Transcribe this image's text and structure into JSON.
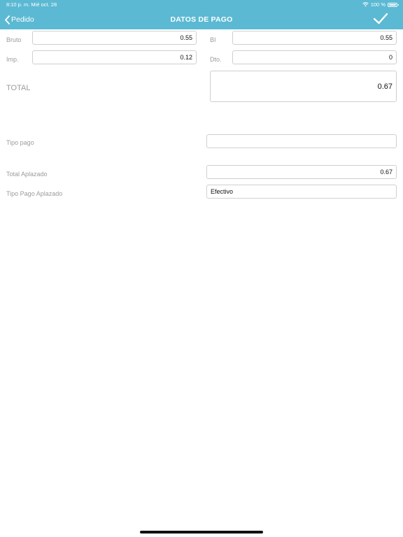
{
  "status_bar": {
    "time": "8:10 p. m.   Mié oct. 28",
    "battery": "100 %"
  },
  "nav": {
    "back_label": "Pedido",
    "title": "DATOS DE PAGO"
  },
  "form": {
    "bruto": {
      "label": "Bruto",
      "value": "0.55"
    },
    "bi": {
      "label": "BI",
      "value": "0.55"
    },
    "imp": {
      "label": "Imp.",
      "value": "0.12"
    },
    "dto": {
      "label": "Dto.",
      "value": "0"
    },
    "total": {
      "label": "TOTAL",
      "value": "0.67"
    },
    "tipo_pago": {
      "label": "Tipo pago",
      "value": ""
    },
    "total_aplazado": {
      "label": "Total Aplazado",
      "value": "0.67"
    },
    "tipo_pago_aplazado": {
      "label": "Tipo Pago Aplazado",
      "value": "Efectivo"
    }
  },
  "colors": {
    "header": "#5bb9d3"
  }
}
